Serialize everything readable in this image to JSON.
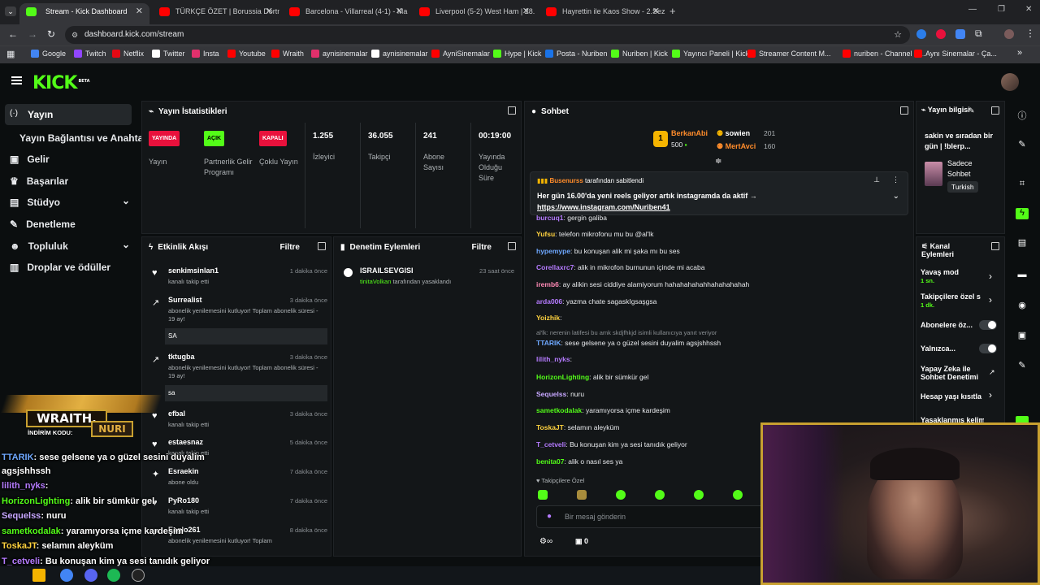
{
  "browser": {
    "tabs": [
      {
        "label": "Stream - Kick Dashboard",
        "color": "#53fc18",
        "active": true
      },
      {
        "label": "TÜRKÇE ÖZET | Borussia Dortm",
        "color": "#ff0000"
      },
      {
        "label": "Barcelona - Villarreal (4-1) - Ma",
        "color": "#ff0000"
      },
      {
        "label": "Liverpool (5-2) West Ham | 28.",
        "color": "#ff0000"
      },
      {
        "label": "Hayrettin ile Kaos Show - 2.Sez",
        "color": "#ff0000"
      }
    ],
    "url": "dashboard.kick.com/stream",
    "bookmarks": [
      {
        "label": "Google",
        "color": "#4285f4"
      },
      {
        "label": "Twitch",
        "color": "#9146ff"
      },
      {
        "label": "Netflix",
        "color": "#e50914"
      },
      {
        "label": "Twitter",
        "color": "#ffffff"
      },
      {
        "label": "Insta",
        "color": "#e1306c"
      },
      {
        "label": "Youtube",
        "color": "#ff0000"
      },
      {
        "label": "Wraith",
        "color": "#ff0000"
      },
      {
        "label": "aynisinemalar",
        "color": "#e1306c"
      },
      {
        "label": "aynisinemalar",
        "color": "#ffffff"
      },
      {
        "label": "AyniSinemalar",
        "color": "#ff0000"
      },
      {
        "label": "Hype | Kick",
        "color": "#53fc18"
      },
      {
        "label": "Posta - Nuriben",
        "color": "#1a73e8"
      },
      {
        "label": "Nuriben | Kick",
        "color": "#53fc18"
      },
      {
        "label": "Yayıncı Paneli | Kick",
        "color": "#53fc18"
      },
      {
        "label": "Streamer Content M...",
        "color": "#ff0000"
      },
      {
        "label": "nuriben - Channel S...",
        "color": "#ff0000"
      },
      {
        "label": "Aynı Sinemalar - Ça...",
        "color": "#ff0000"
      }
    ]
  },
  "kick": {
    "logo": "KICK",
    "beta": "BETA"
  },
  "sidebar": {
    "items": [
      {
        "label": "Yayın",
        "icon": "broadcast-icon",
        "active": true
      },
      {
        "label": "Yayın Bağlantısı ve Anahtarı"
      },
      {
        "label": "Gelir",
        "icon": "money-icon"
      },
      {
        "label": "Başarılar",
        "icon": "trophy-icon"
      },
      {
        "label": "Stüdyo",
        "icon": "studio-icon",
        "chevron": true
      },
      {
        "label": "Denetleme",
        "icon": "wrench-icon"
      },
      {
        "label": "Topluluk",
        "icon": "people-icon",
        "chevron": true
      },
      {
        "label": "Droplar ve ödüller",
        "icon": "gift-icon"
      }
    ]
  },
  "stats": {
    "title": "Yayın İstatistikleri",
    "items": [
      {
        "badge": "YAYINDA",
        "badge_color": "#e9113c",
        "label": "Yayın"
      },
      {
        "badge": "AÇIK",
        "badge_color": "#53fc18",
        "label": "Partnerlik Gelir Programı"
      },
      {
        "badge": "KAPALI",
        "badge_color": "#e9113c",
        "label": "Çoklu Yayın"
      },
      {
        "value": "1.255",
        "label": "İzleyici"
      },
      {
        "value": "36.055",
        "label": "Takipçi"
      },
      {
        "value": "241",
        "label": "Abone Sayısı"
      },
      {
        "value": "00:19:00",
        "label": "Yayında Olduğu Süre"
      }
    ]
  },
  "activity": {
    "title": "Etkinlik Akışı",
    "filter": "Filtre",
    "events": [
      {
        "name": "senkimsinlan1",
        "time": "1 dakika önce",
        "sub": "kanalı takip etti",
        "icon": "heart-icon"
      },
      {
        "name": "Surrealist",
        "time": "3 dakika önce",
        "sub": "abonelik yenilemesini kutluyor! Toplam abonelik süresi - 19 ay!",
        "msg": "SA",
        "icon": "sub-icon"
      },
      {
        "name": "tktugba",
        "time": "3 dakika önce",
        "sub": "abonelik yenilemesini kutluyor! Toplam abonelik süresi - 19 ay!",
        "msg": "sa",
        "icon": "sub-icon"
      },
      {
        "name": "efbal",
        "time": "3 dakika önce",
        "sub": "kanalı takip etti",
        "icon": "heart-icon"
      },
      {
        "name": "estaesnaz",
        "time": "5 dakika önce",
        "sub": "kanalı takip etti",
        "icon": "heart-icon"
      },
      {
        "name": "Esraekin",
        "time": "7 dakika önce",
        "sub": "abone oldu",
        "icon": "star-icon"
      },
      {
        "name": "PyRo180",
        "time": "7 dakika önce",
        "sub": "kanalı takip etti",
        "icon": "heart-icon"
      },
      {
        "name": "Eaglo261",
        "time": "8 dakika önce",
        "sub": "abonelik yenilemesini kutluyor! Toplam",
        "icon": "sub-icon"
      }
    ]
  },
  "moderation": {
    "title": "Denetim Eylemleri",
    "filter": "Filtre",
    "entries": [
      {
        "name": "ISRAILSEVGISI",
        "time": "23 saat önce",
        "actor": "tinitaVolkan",
        "action": "tarafından yasaklandı"
      }
    ]
  },
  "chat": {
    "title": "Sohbet",
    "leaders": [
      {
        "rank": "1",
        "name": "BerkanAbi",
        "value": "500"
      },
      {
        "name": "sowien",
        "value": "201"
      },
      {
        "name": "MertAvci",
        "value": "160"
      }
    ],
    "pinned": {
      "user": "Busenurss",
      "by": "tarafından sabitlendi",
      "text": "Her gün 16.00'da yeni reels geliyor artık instagramda da aktif →",
      "link": "https://www.instagram.com/Nuriben41"
    },
    "messages": [
      {
        "user": "burcuq1",
        "color": "#b57bff",
        "text": "gergin galiba"
      },
      {
        "user": "Yufsu",
        "color": "#ffd23f",
        "text": "telefon mikrofonu mu bu @al'lk"
      },
      {
        "user": "hypemype",
        "color": "#6ea8ff",
        "text": "bu konuşan alik mi şaka mı bu ses"
      },
      {
        "user": "Corellaxrc7",
        "color": "#b57bff",
        "text": "alik in mikrofon burnunun içinde mi acaba"
      },
      {
        "user": "iremb6",
        "color": "#ff8ab5",
        "text": "ay alikin sesi ciddiye alamiyorum hahahahahahhahahahahah"
      },
      {
        "user": "arda006",
        "color": "#b57bff",
        "text": "yazma chate sagaskIgsaşgsa"
      },
      {
        "user": "Yoizhik",
        "color": "#ffd23f",
        "text": ""
      },
      {
        "user": "",
        "color": "#8a8f93",
        "text": "al'lk: nerenin latifesi bu amk skdjfhkjd isimli kullanıcıya yanıt veriyor"
      },
      {
        "user": "TTARIK",
        "color": "#6ea8ff",
        "text": "sese gelsene ya o güzel sesini duyalim agsjshhssh"
      },
      {
        "user": "lilith_nyks",
        "color": "#b57bff",
        "text": ""
      },
      {
        "user": "HorizonLighting",
        "color": "#53fc18",
        "text": "alik bir sümkür gel"
      },
      {
        "user": "Sequelss",
        "color": "#c7a7ff",
        "text": "nuru"
      },
      {
        "user": "sametkodalak",
        "color": "#53fc18",
        "text": "yaramıyorsa içme kardeşim"
      },
      {
        "user": "ToskaJT",
        "color": "#ffd23f",
        "text": "selamın aleyküm"
      },
      {
        "user": "T_cetveli",
        "color": "#b57bff",
        "text": "Bu konuşan kim ya sesi tanıdık geliyor"
      },
      {
        "user": "benita07",
        "color": "#53fc18",
        "text": "alik o nasıl ses ya"
      }
    ],
    "followers_only": "Takipçilere Özel",
    "input_placeholder": "Bir mesaj gönderin",
    "count": "0"
  },
  "stream_info": {
    "title": "Yayın bilgisi",
    "desc": "sakin ve sıradan bir gün | !blerp...",
    "category": "Sadece Sohbet",
    "language": "Turkish"
  },
  "channel_actions": {
    "title": "Kanal Eylemleri",
    "items": [
      {
        "label": "Yavaş mod",
        "sub": "1 sn."
      },
      {
        "label": "Takipçilere özel s",
        "sub": "1 dk."
      },
      {
        "label": "Abonelere öz..."
      },
      {
        "label": "Yalnızca..."
      },
      {
        "label": "Yapay Zeka ile Sohbet Denetimi"
      },
      {
        "label": "Hesap yaşı kısıtla"
      },
      {
        "label": "Yasaklanmış kelim"
      }
    ]
  },
  "overlay": {
    "sponsor": "WRAITH.",
    "code_label": "İNDİRİM KODU:",
    "code": "NURI",
    "lines": [
      {
        "user": "TTARIK",
        "color": "#6ea8ff",
        "text": ": sese gelsene ya o güzel sesini duyalim"
      },
      {
        "user": "agsjshhssh",
        "color": "#ffffff",
        "text": ""
      },
      {
        "user": "lilith_nyks",
        "color": "#b57bff",
        "text": ":"
      },
      {
        "user": "HorizonLighting",
        "color": "#53fc18",
        "text": ": alik bir sümkür gel"
      },
      {
        "user": "Sequelss",
        "color": "#c7a7ff",
        "text": ": nuru"
      },
      {
        "user": "sametkodalak",
        "color": "#53fc18",
        "text": ": yaramıyorsa içme kardeşim"
      },
      {
        "user": "ToskaJT",
        "color": "#ffd23f",
        "text": ": selamın aleyküm"
      },
      {
        "user": "T_cetveli",
        "color": "#b57bff",
        "text": ": Bu konuşan kim ya sesi tanıdık geliyor"
      },
      {
        "user": "benita07",
        "color": "#53fc18",
        "text": ": alik o nasıl ses ya"
      }
    ]
  }
}
